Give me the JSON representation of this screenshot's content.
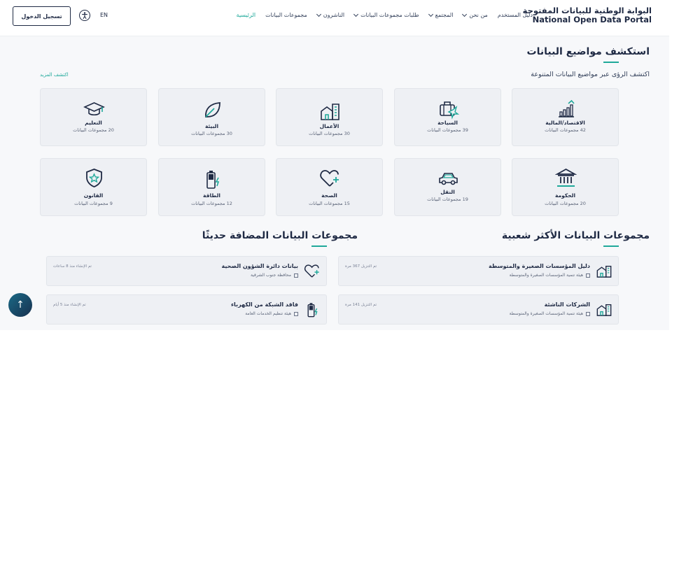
{
  "header": {
    "logo_ar": "البوابة الوطنية للبيانات المفتوحة",
    "logo_en": "National Open Data Portal",
    "nav": [
      {
        "label": "الرئيسية",
        "active": true,
        "dropdown": false
      },
      {
        "label": "مجموعات البيانات",
        "active": false,
        "dropdown": false
      },
      {
        "label": "الناشرون",
        "active": false,
        "dropdown": true
      },
      {
        "label": "طلبات مجموعات البيانات",
        "active": false,
        "dropdown": true
      },
      {
        "label": "المجتمع",
        "active": false,
        "dropdown": true
      },
      {
        "label": "من نحن",
        "active": false,
        "dropdown": true
      },
      {
        "label": "دليل المستخدم",
        "active": false,
        "dropdown": false
      }
    ],
    "lang": "EN",
    "login": "تسجيل الدخول"
  },
  "topics": {
    "title": "استكشف مواضيع البيانات",
    "subtitle": "اكتشف الرؤى عبر مواضيع البيانات المتنوعة",
    "more": "اكتشف المزيد",
    "cards": [
      {
        "name": "الاقتصاد/المالية",
        "count": "42 مجموعات البيانات",
        "icon": "chart-growth-icon"
      },
      {
        "name": "السياحة",
        "count": "39 مجموعات البيانات",
        "icon": "suitcase-icon"
      },
      {
        "name": "الأعمال",
        "count": "30 مجموعات البيانات",
        "icon": "buildings-icon"
      },
      {
        "name": "البيئة",
        "count": "30 مجموعات البيانات",
        "icon": "leaf-icon"
      },
      {
        "name": "التعليم",
        "count": "20 مجموعات البيانات",
        "icon": "graduation-cap-icon"
      },
      {
        "name": "الحكومة",
        "count": "20 مجموعات البيانات",
        "icon": "government-building-icon"
      },
      {
        "name": "النقل",
        "count": "19 مجموعات البيانات",
        "icon": "car-icon"
      },
      {
        "name": "الصحة",
        "count": "15 مجموعات البيانات",
        "icon": "heart-plus-icon"
      },
      {
        "name": "الطاقة",
        "count": "12 مجموعات البيانات",
        "icon": "battery-icon"
      },
      {
        "name": "القانون",
        "count": "9 مجموعات البيانات",
        "icon": "shield-star-icon"
      }
    ]
  },
  "popular": {
    "title": "مجموعات البيانات الأكثر شعبية",
    "items": [
      {
        "title": "دليل المؤسسات الصغيرة والمتوسطة",
        "publisher": "هيئة تنمية المؤسسات الصغيرة والمتوسطة",
        "meta": "تم التنزيل 367 مرة"
      },
      {
        "title": "الشركات الناشئة",
        "publisher": "هيئة تنمية المؤسسات الصغيرة والمتوسطة",
        "meta": "تم التنزيل 141 مرة"
      }
    ]
  },
  "recent": {
    "title": "مجموعات البيانات المضافة حديثًا",
    "items": [
      {
        "title": "بيانات دائرة الشؤون الصحية",
        "publisher": "محافظة جنوب الشرقية",
        "meta": "تم الإنشاء منذ 8 ساعات"
      },
      {
        "title": "فاقد الشبكة من الكهرباء",
        "publisher": "هيئة تنظيم الخدمات العامة",
        "meta": "تم الإنشاء منذ 5 أيام"
      }
    ]
  },
  "scroll_top": "↑",
  "colors": {
    "accent": "#1fa99a",
    "navy": "#1f2a44",
    "card_bg": "#eef0f4"
  }
}
